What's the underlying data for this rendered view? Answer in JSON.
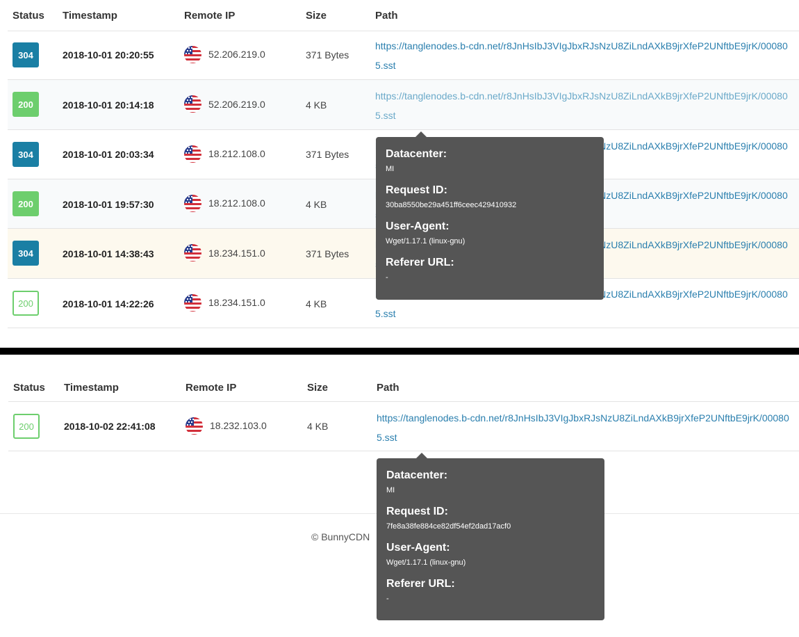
{
  "headers": {
    "status": "Status",
    "timestamp": "Timestamp",
    "remote_ip": "Remote IP",
    "size": "Size",
    "path": "Path"
  },
  "rows": [
    {
      "status": "304",
      "timestamp": "2018-10-01 20:20:55",
      "ip": "52.206.219.0",
      "size": "371 Bytes",
      "path": "https://tanglenodes.b-cdn.net/r8JnHsIbJ3VIgJbxRJsNzU8ZiLndAXkB9jrXfeP2UNftbE9jrK/000805.sst"
    },
    {
      "status": "200",
      "timestamp": "2018-10-01 20:14:18",
      "ip": "52.206.219.0",
      "size": "4 KB",
      "path": "https://tanglenodes.b-cdn.net/r8JnHsIbJ3VIgJbxRJsNzU8ZiLndAXkB9jrXfeP2UNftbE9jrK/000805.sst"
    },
    {
      "status": "304",
      "timestamp": "2018-10-01 20:03:34",
      "ip": "18.212.108.0",
      "size": "371 Bytes",
      "path": "https://tanglenodes.b-cdn.net/r8JnHsIbJ3VIgJbxRJsNzU8ZiLndAXkB9jrXfeP2UNftbE9jrK/000805.sst"
    },
    {
      "status": "200",
      "timestamp": "2018-10-01 19:57:30",
      "ip": "18.212.108.0",
      "size": "4 KB",
      "path": "https://tanglenodes.b-cdn.net/r8JnHsIbJ3VIgJbxRJsNzU8ZiLndAXkB9jrXfeP2UNftbE9jrK/000805.sst"
    },
    {
      "status": "304",
      "timestamp": "2018-10-01 14:38:43",
      "ip": "18.234.151.0",
      "size": "371 Bytes",
      "path": "https://tanglenodes.b-cdn.net/r8JnHsIbJ3VIgJbxRJsNzU8ZiLndAXkB9jrXfeP2UNftbE9jrK/000805.sst"
    },
    {
      "status": "200",
      "timestamp": "2018-10-01 14:22:26",
      "ip": "18.234.151.0",
      "size": "4 KB",
      "path": "https://tanglenodes.b-cdn.net/r8JnHsIbJ3VIgJbxRJsNzU8ZiLndAXkB9jrXfeP2UNftbE9jrK/000805.sst"
    }
  ],
  "tooltip1": {
    "datacenter_label": "Datacenter:",
    "datacenter": "MI",
    "request_id_label": "Request ID:",
    "request_id": "30ba8550be29a451ff6ceec429410932",
    "user_agent_label": "User-Agent:",
    "user_agent": "Wget/1.17.1 (linux-gnu)",
    "referer_label": "Referer URL:",
    "referer": "-"
  },
  "rows2": [
    {
      "status": "200",
      "timestamp": "2018-10-02 22:41:08",
      "ip": "18.232.103.0",
      "size": "4 KB",
      "path": "https://tanglenodes.b-cdn.net/r8JnHsIbJ3VIgJbxRJsNzU8ZiLndAXkB9jrXfeP2UNftbE9jrK/000805.sst"
    }
  ],
  "tooltip2": {
    "datacenter_label": "Datacenter:",
    "datacenter": "MI",
    "request_id_label": "Request ID:",
    "request_id": "7fe8a38fe884ce82df54ef2dad17acf0",
    "user_agent_label": "User-Agent:",
    "user_agent": "Wget/1.17.1 (linux-gnu)",
    "referer_label": "Referer URL:",
    "referer": "-"
  },
  "footer": {
    "copyright": "© BunnyCDN"
  },
  "colors": {
    "status_304": "#1a7fa4",
    "status_200": "#6dce6d",
    "link": "#2a7fae",
    "tooltip_bg": "#555555"
  },
  "icons": {
    "flag": "us-flag-icon"
  }
}
